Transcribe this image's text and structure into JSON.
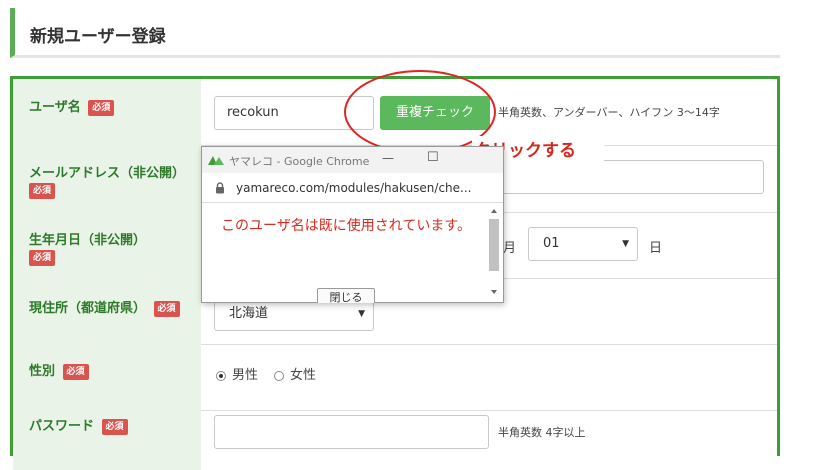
{
  "page": {
    "title": "新規ユーザー登録"
  },
  "required_badge": "必須",
  "rows": {
    "username": {
      "label": "ユーザ名",
      "value": "recokun",
      "check_button": "重複チェック",
      "hint": "半角英数、アンダーバー、ハイフン 3〜14字"
    },
    "email": {
      "label": "メールアドレス（非公開）"
    },
    "birthdate": {
      "label": "生年月日（非公開）",
      "month_suffix": "月",
      "day_value": "01",
      "day_suffix": "日"
    },
    "prefecture": {
      "label": "現住所（都道府県）",
      "value": "北海道"
    },
    "gender": {
      "label": "性別",
      "male": "男性",
      "female": "女性",
      "selected": "男性"
    },
    "password": {
      "label": "パスワード",
      "hint": "半角英数 4字以上"
    }
  },
  "annotation": {
    "click_text": "クリックする",
    "color": "#e02424"
  },
  "popup": {
    "window_title": "ヤマレコ - Google Chrome",
    "url": "yamareco.com/modules/hakusen/che...",
    "message": "このユーザ名は既に使用されています。",
    "close_button": "閉じる",
    "min_glyph": "—",
    "max_glyph": "☐"
  },
  "colors": {
    "accent_green": "#3e9d35",
    "label_bg": "#eaf3e7",
    "badge_red": "#d9534f",
    "button_green": "#5cb85c"
  }
}
